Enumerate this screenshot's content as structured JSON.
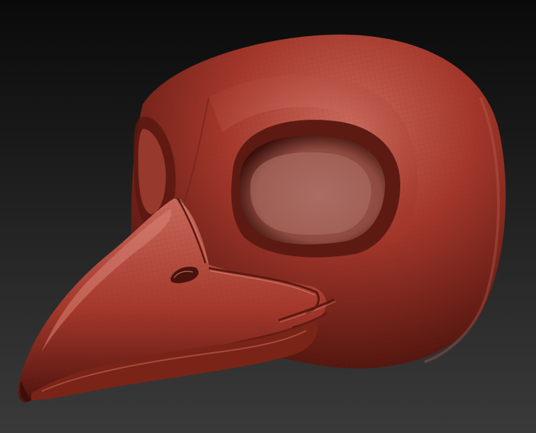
{
  "scene": {
    "subject": "sculpted-bird-skull",
    "colors": {
      "background_top": "#0a0a0a",
      "background_bottom": "#3a3a3a",
      "clay_base": "#a4372b",
      "clay_highlight": "#c96a5c",
      "clay_shadow": "#4e140e",
      "eye_socket": "#a6685f",
      "wireframe": "#7a2418"
    }
  }
}
